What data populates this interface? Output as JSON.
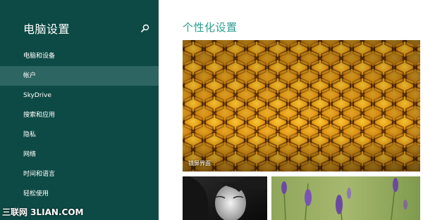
{
  "sidebar": {
    "title": "电脑设置",
    "search_icon": "search-icon",
    "items": [
      {
        "label": "电脑和设备",
        "selected": false
      },
      {
        "label": "帐户",
        "selected": true
      },
      {
        "label": "SkyDrive",
        "selected": false
      },
      {
        "label": "搜索和应用",
        "selected": false
      },
      {
        "label": "隐私",
        "selected": false
      },
      {
        "label": "网络",
        "selected": false
      },
      {
        "label": "时间和语言",
        "selected": false
      },
      {
        "label": "轻松使用",
        "selected": false
      }
    ],
    "colors": {
      "background": "#0e4a45",
      "selected_background": "#2c6561",
      "text": "#ffffff"
    }
  },
  "main": {
    "title": "个性化设置",
    "title_color": "#2a9d8f",
    "tiles": [
      {
        "label": "锁屏界面",
        "image": "honeycomb-photo"
      },
      {
        "label": "",
        "image": "black-white-portrait-photo"
      },
      {
        "label": "",
        "image": "lavender-flowers-photo"
      }
    ]
  },
  "watermark": {
    "text": "三联网 3LIAN.COM"
  }
}
